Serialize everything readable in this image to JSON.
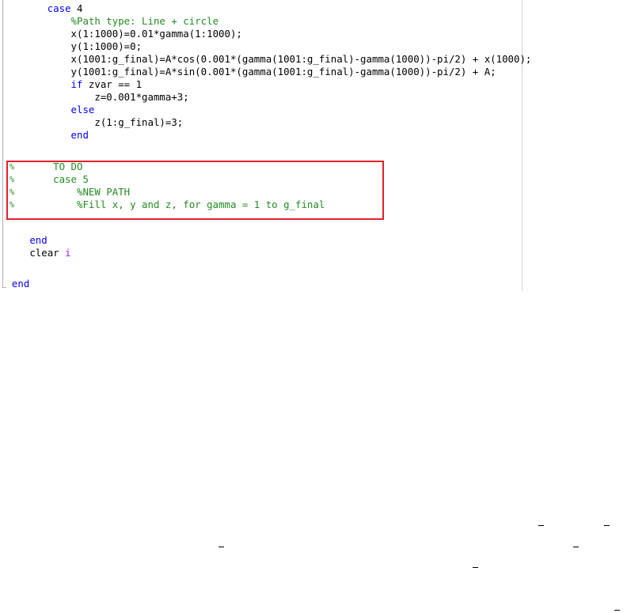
{
  "editor": {
    "lines": [
      {
        "indent": "        ",
        "kw": "case",
        "rest": " 4"
      },
      {
        "indent": "            ",
        "comment": "%Path type: Line + circle"
      },
      {
        "indent": "            ",
        "code": "x(1:1000)=0.01*gamma(1:1000);"
      },
      {
        "indent": "            ",
        "code": "y(1:1000)=0;"
      },
      {
        "indent": "            ",
        "code": "x(1001:g_final)=A*cos(0.001*(gamma(1001:g_final)-gamma(1000))-pi/2) + x(1000);"
      },
      {
        "indent": "            ",
        "code": "y(1001:g_final)=A*sin(0.001*(gamma(1001:g_final)-gamma(1000))-pi/2) + A;"
      },
      {
        "indent": "            ",
        "kw": "if",
        "rest": " zvar == 1"
      },
      {
        "indent": "                ",
        "code": "z=0.001*gamma+3;"
      },
      {
        "indent": "            ",
        "kw": "else"
      },
      {
        "indent": "                ",
        "code": "z(1:g_final)=3;"
      },
      {
        "indent": "            ",
        "kw": "end"
      },
      {
        "indent": "         ",
        "comment": "TO DO",
        "commented_out": true
      },
      {
        "indent": "         ",
        "comment": "case 5",
        "commented_out": true
      },
      {
        "indent": "             ",
        "comment": "%NEW PATH",
        "commented_out": true
      },
      {
        "indent": "             ",
        "comment": "%Fill x, y and z, for gamma = 1 to g_final",
        "commented_out": true
      },
      {
        "indent": "",
        "code": ""
      },
      {
        "indent": "     ",
        "kw": "end"
      },
      {
        "indent": "     ",
        "code": "clear ",
        "var": "i"
      },
      {
        "indent": "",
        "code": ""
      },
      {
        "indent": "  ",
        "kw": "end"
      }
    ],
    "comment_marker": "%",
    "highlight_color": "#e3202b",
    "keyword_color": "#0000ff",
    "comment_color": "#228b22",
    "variable_color": "#a020f0"
  }
}
